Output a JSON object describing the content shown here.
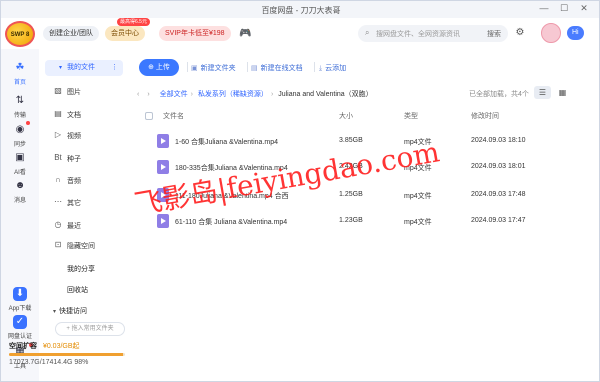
{
  "titlebar": {
    "title": "百度网盘 - 刀刀大表哥"
  },
  "topbar": {
    "logo_text": "SWP 8",
    "org_label": "创建企业/团队",
    "vip_label": "会员中心",
    "vip_badge": "最高得6.5元",
    "svip_label": "SVIP年卡低至¥198",
    "search_placeholder": "搜网盘文件、全网资源资讯",
    "search_button": "搜索",
    "hi_label": "Hi"
  },
  "rail": {
    "items": [
      {
        "label": "首页",
        "icon": "home-icon"
      },
      {
        "label": "传输",
        "icon": "transfer-icon"
      },
      {
        "label": "同步",
        "icon": "sync-icon"
      },
      {
        "label": "AI看",
        "icon": "ai-view-icon"
      },
      {
        "label": "消息",
        "icon": "message-icon"
      }
    ],
    "bottom": [
      {
        "label": "App下载",
        "icon": "app-download-icon"
      },
      {
        "label": "网盘认证",
        "icon": "verify-icon"
      },
      {
        "label": "工具",
        "icon": "tools-icon"
      }
    ]
  },
  "sidebar": {
    "my_files": "我的文件",
    "items": [
      {
        "label": "图片",
        "icon": "image-icon"
      },
      {
        "label": "文档",
        "icon": "document-icon"
      },
      {
        "label": "视频",
        "icon": "video-icon"
      },
      {
        "label": "种子",
        "icon": "torrent-icon"
      },
      {
        "label": "音频",
        "icon": "audio-icon"
      },
      {
        "label": "其它",
        "icon": "other-icon"
      },
      {
        "label": "最近",
        "icon": "recent-icon"
      },
      {
        "label": "隐藏空间",
        "icon": "hidden-space-icon"
      }
    ],
    "my_share": "我的分享",
    "recycle": "回收站",
    "quick_access": "快捷访问",
    "add_quick": "+ 拖入常用文件夹",
    "quota_title": "空间扩容",
    "quota_price": "¥0.03/GB起",
    "usage_fraction": 0.98,
    "usage_text": "17073.7G/17414.4G 98%"
  },
  "toolbar": {
    "upload": "上传",
    "new_folder": "新建文件夹",
    "new_doc": "新建在线文档",
    "cloud_add": "云添加"
  },
  "breadcrumb": {
    "root": "全部文件",
    "mid": "私发系列（稀缺资源）",
    "current": "Juliana and Valentina（双胞）",
    "loaded": "已全部加载，共4个"
  },
  "table": {
    "headers": {
      "name": "文件名",
      "size": "大小",
      "type": "类型",
      "modified": "修改时间"
    },
    "rows": [
      {
        "name": "1-60 合集Juliana &Valentina.mp4",
        "size": "3.85GB",
        "type": "mp4文件",
        "modified": "2024.09.03 18:10"
      },
      {
        "name": "180-335合集Juliana &Valentina.mp4",
        "size": "2.42GB",
        "type": "mp4文件",
        "modified": "2024.09.03 18:01"
      },
      {
        "name": "111-180Juliana &Valentina.mp4 合西",
        "size": "1.25GB",
        "type": "mp4文件",
        "modified": "2024.09.03 17:48"
      },
      {
        "name": "61-110 合集 Juliana &Valentina.mp4",
        "size": "1.23GB",
        "type": "mp4文件",
        "modified": "2024.09.03 17:47"
      }
    ]
  },
  "watermark": "飞影岛|feiyingdao.com",
  "colors": {
    "accent": "#3b78ff",
    "watermark": "#ff1f1f",
    "file_icon": "#8f7ee6"
  }
}
